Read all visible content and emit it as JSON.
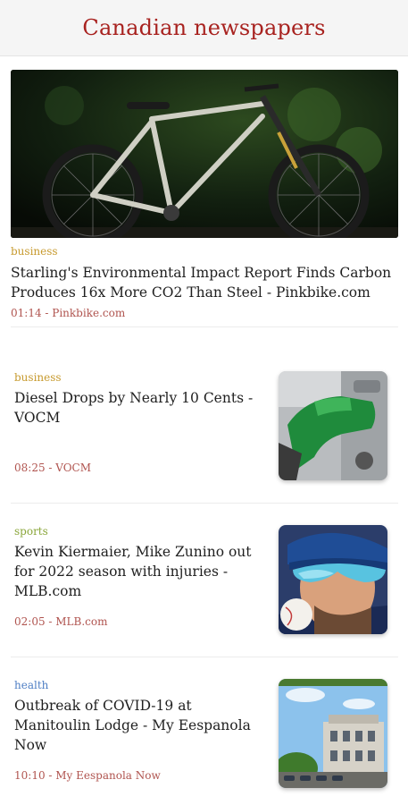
{
  "header": {
    "title": "Canadian newspapers"
  },
  "featured": {
    "category": "business",
    "title": "Starling's Environmental Impact Report Finds Carbon Produces 16x More CO2 Than Steel - Pinkbike.com",
    "meta": "01:14 - Pinkbike.com",
    "image_icon": "bicycle-photo"
  },
  "articles": [
    {
      "category": "business",
      "category_color": "#c79a2e",
      "title": "Diesel Drops by Nearly 10 Cents - VOCM",
      "meta": "08:25 - VOCM",
      "image_icon": "fuel-nozzle-photo"
    },
    {
      "category": "sports",
      "category_color": "#8aa63a",
      "title": "Kevin Kiermaier, Mike Zunino out for 2022 season with injuries - MLB.com",
      "meta": "02:05 - MLB.com",
      "image_icon": "baseball-player-photo"
    },
    {
      "category": "health",
      "category_color": "#4f7fc4",
      "title": "Outbreak of COVID-19 at Manitoulin Lodge - My Eespanola Now",
      "meta": "10:10 - My Eespanola Now",
      "image_icon": "building-photo"
    }
  ],
  "colors": {
    "header_title": "#a8221f",
    "meta": "#b0544f",
    "header_bg": "#f5f5f5"
  }
}
